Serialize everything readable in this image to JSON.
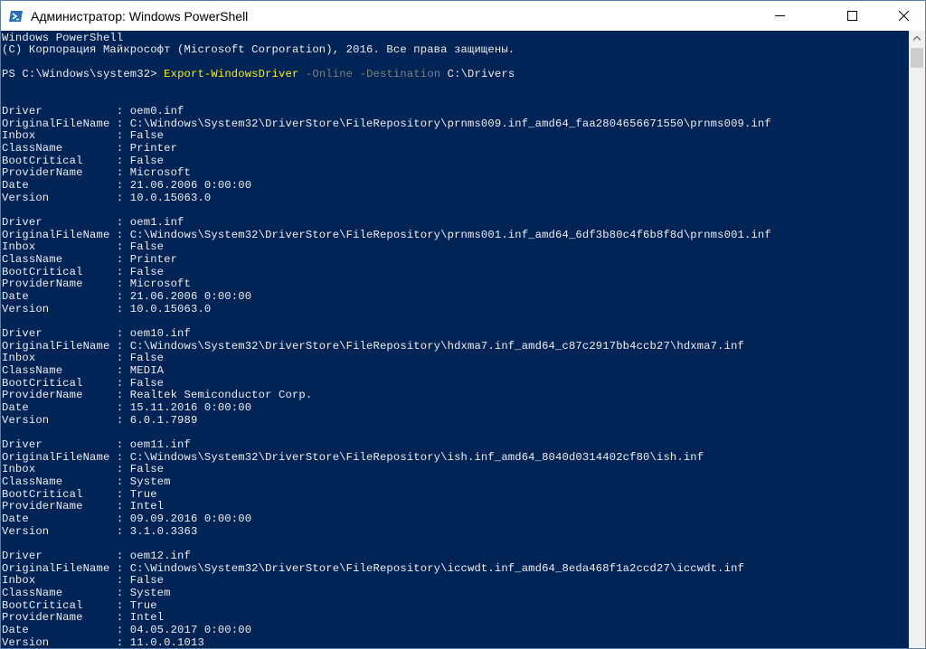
{
  "window": {
    "title": "Администратор: Windows PowerShell",
    "icon": "powershell-icon",
    "controls": [
      "minimize-icon",
      "maximize-icon",
      "close-icon"
    ]
  },
  "colors": {
    "console_bg": "#012456",
    "text": "#eeedf0",
    "command": "#fef100",
    "parameter": "#808080"
  },
  "console": {
    "header": [
      "Windows PowerShell",
      "(C) Корпорация Майкрософт (Microsoft Corporation), 2016. Все права защищены."
    ],
    "prompt": {
      "path": "PS C:\\Windows\\system32> ",
      "command": "Export-WindowsDriver",
      "param1": "-Online",
      "param2": "-Destination",
      "argument": "C:\\Drivers"
    },
    "records": [
      {
        "driver": "Driver           : oem0.inf",
        "original": "OriginalFileName : C:\\Windows\\System32\\DriverStore\\FileRepository\\prnms009.inf_amd64_faa2804656671550\\prnms009.inf",
        "inbox": "Inbox            : False",
        "classname": "ClassName        : Printer",
        "bootcritical": "BootCritical     : False",
        "provider": "ProviderName     : Microsoft",
        "date": "Date             : 21.06.2006 0:00:00",
        "version": "Version          : 10.0.15063.0"
      },
      {
        "driver": "Driver           : oem1.inf",
        "original": "OriginalFileName : C:\\Windows\\System32\\DriverStore\\FileRepository\\prnms001.inf_amd64_6df3b80c4f6b8f8d\\prnms001.inf",
        "inbox": "Inbox            : False",
        "classname": "ClassName        : Printer",
        "bootcritical": "BootCritical     : False",
        "provider": "ProviderName     : Microsoft",
        "date": "Date             : 21.06.2006 0:00:00",
        "version": "Version          : 10.0.15063.0"
      },
      {
        "driver": "Driver           : oem10.inf",
        "original": "OriginalFileName : C:\\Windows\\System32\\DriverStore\\FileRepository\\hdxma7.inf_amd64_c87c2917bb4ccb27\\hdxma7.inf",
        "inbox": "Inbox            : False",
        "classname": "ClassName        : MEDIA",
        "bootcritical": "BootCritical     : False",
        "provider": "ProviderName     : Realtek Semiconductor Corp.",
        "date": "Date             : 15.11.2016 0:00:00",
        "version": "Version          : 6.0.1.7989"
      },
      {
        "driver": "Driver           : oem11.inf",
        "original": "OriginalFileName : C:\\Windows\\System32\\DriverStore\\FileRepository\\ish.inf_amd64_8040d0314402cf80\\ish.inf",
        "inbox": "Inbox            : False",
        "classname": "ClassName        : System",
        "bootcritical": "BootCritical     : True",
        "provider": "ProviderName     : Intel",
        "date": "Date             : 09.09.2016 0:00:00",
        "version": "Version          : 3.1.0.3363"
      },
      {
        "driver": "Driver           : oem12.inf",
        "original": "OriginalFileName : C:\\Windows\\System32\\DriverStore\\FileRepository\\iccwdt.inf_amd64_8eda468f1a2ccd27\\iccwdt.inf",
        "inbox": "Inbox            : False",
        "classname": "ClassName        : System",
        "bootcritical": "BootCritical     : True",
        "provider": "ProviderName     : Intel",
        "date": "Date             : 04.05.2017 0:00:00",
        "version": "Version          : 11.0.0.1013"
      }
    ]
  }
}
